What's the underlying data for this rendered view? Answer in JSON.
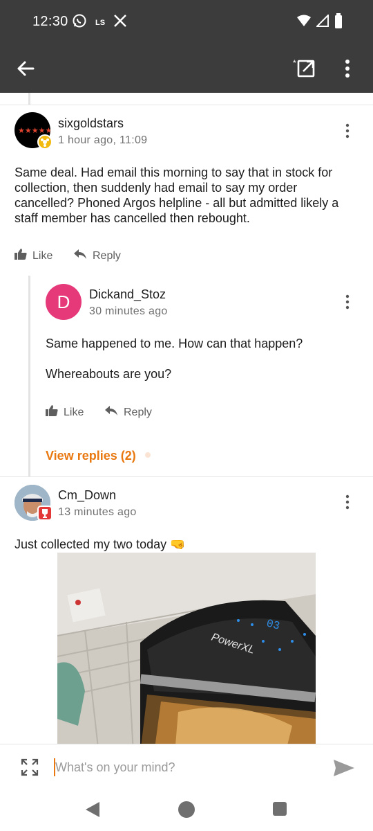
{
  "status_bar": {
    "time": "12:30",
    "left_icons": [
      "whatsapp-icon",
      "ls-icon",
      "x-icon"
    ],
    "ls_label": "LS",
    "right_icons": [
      "wifi-icon",
      "signal-icon",
      "battery-icon"
    ]
  },
  "app_bar": {
    "icons": [
      "back-arrow-icon",
      "open-external-icon",
      "more-vert-icon"
    ]
  },
  "comments": [
    {
      "username": "sixgoldstars",
      "timestamp": "1 hour ago, 11:09",
      "body": "Same deal. Had email this morning to say that in stock for collection, then suddenly had email to say my order cancelled? Phoned Argos helpline - all but admitted likely a staff member has cancelled then rebought.",
      "like_label": "Like",
      "reply_label": "Reply"
    },
    {
      "username": "Dickand_Stoz",
      "avatar_letter": "D",
      "timestamp": "30 minutes ago",
      "body_lines": [
        "Same happened to me. How can that happen?",
        "Whereabouts are you?"
      ],
      "like_label": "Like",
      "reply_label": "Reply",
      "view_replies": "View replies (2)"
    },
    {
      "username": "Cm_Down",
      "timestamp": "13 minutes ago",
      "body": "Just collected my two today 🤜",
      "image_text": [
        "03",
        "PowerXL"
      ]
    }
  ],
  "composer": {
    "placeholder": "What's on your mind?"
  },
  "colors": {
    "bar": "#3c3c3c",
    "accent": "#e8780f",
    "avatar_pink": "#e6397a",
    "text_muted": "#707070"
  }
}
